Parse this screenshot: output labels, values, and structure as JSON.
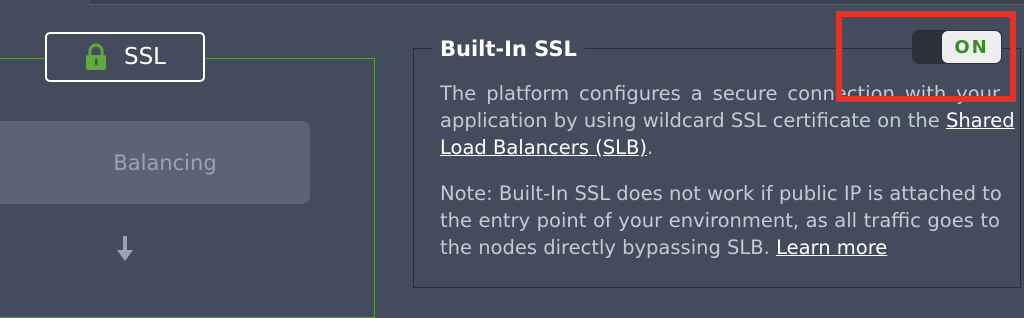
{
  "left": {
    "ssl_label": "SSL",
    "balancing_label": "Balancing"
  },
  "builtin": {
    "title": "Built-In SSL",
    "toggle_state": "ON",
    "description": {
      "line1": "The platform configures a secure connection with your",
      "line2_prefix": "application by using wildcard SSL certificate on the ",
      "link_part1": "Shared",
      "link_part2": "Load Balancers (SLB)",
      "line3_suffix": "."
    },
    "note": {
      "line1": "Note: Built-In SSL does not work if public IP is attached to",
      "line2": "the entry point of your environment, as all traffic goes to",
      "line3_prefix": "the nodes directly bypassing SLB. ",
      "learn_more": "Learn more"
    }
  },
  "colors": {
    "background": "#434b5c",
    "accent_green": "#5f9a45",
    "highlight_red": "#e63325",
    "toggle_on_text": "#3e8a29"
  }
}
